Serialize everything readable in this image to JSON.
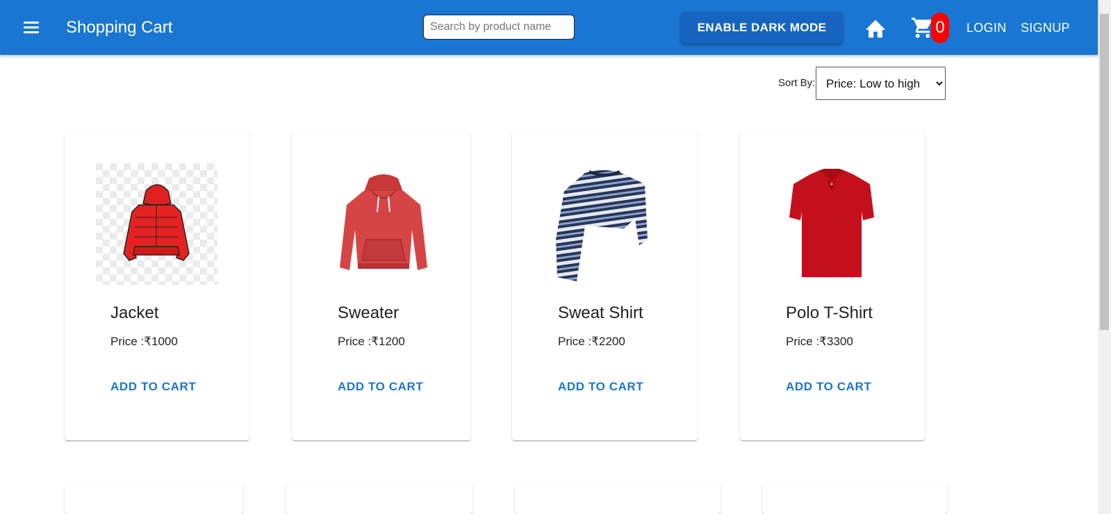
{
  "header": {
    "title": "Shopping Cart",
    "search_placeholder": "Search by product name",
    "dark_mode_label": "ENABLE DARK MODE",
    "cart_count": "0",
    "login_label": "LOGIN",
    "signup_label": "SIGNUP"
  },
  "sort": {
    "label": "Sort By:",
    "selected": "Price: Low to high"
  },
  "products": [
    {
      "name": "Jacket",
      "price": "Price :₹1000",
      "add_label": "ADD TO CART",
      "image_icon": "red-jacket-icon"
    },
    {
      "name": "Sweater",
      "price": "Price :₹1200",
      "add_label": "ADD TO CART",
      "image_icon": "red-hoodie-icon"
    },
    {
      "name": "Sweat Shirt",
      "price": "Price :₹2200",
      "add_label": "ADD TO CART",
      "image_icon": "striped-sweatshirt-icon"
    },
    {
      "name": "Polo T-Shirt",
      "price": "Price :₹3300",
      "add_label": "ADD TO CART",
      "image_icon": "red-polo-icon"
    }
  ],
  "colors": {
    "primary": "#1976d2",
    "badge": "#ff0000",
    "accent_text": "#1976d2"
  }
}
